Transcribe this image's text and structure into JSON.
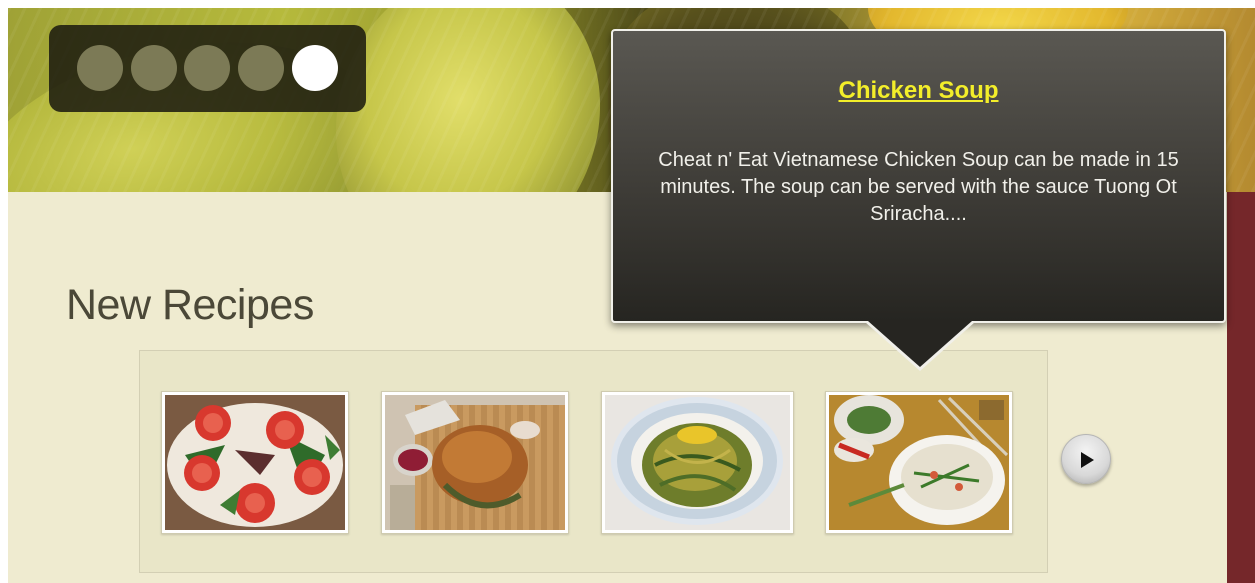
{
  "slider": {
    "dots": [
      {
        "active": false
      },
      {
        "active": false
      },
      {
        "active": false
      },
      {
        "active": false
      },
      {
        "active": true
      }
    ]
  },
  "section": {
    "heading": "New Recipes"
  },
  "carousel": {
    "items": [
      {
        "image": "tomato-pizza"
      },
      {
        "image": "roast-chicken"
      },
      {
        "image": "noodle-bowl"
      },
      {
        "image": "chicken-soup"
      }
    ],
    "next_icon": "play-icon"
  },
  "tooltip": {
    "title": "Chicken Soup",
    "description": "Cheat n' Eat Vietnamese Chicken Soup can be made in 15 minutes. The soup can be served with the sauce Tuong Ot Sriracha...."
  },
  "colors": {
    "page_bg": "#efebd0",
    "tooltip_title": "#f3ee2a",
    "accent_band": "#75272a"
  }
}
